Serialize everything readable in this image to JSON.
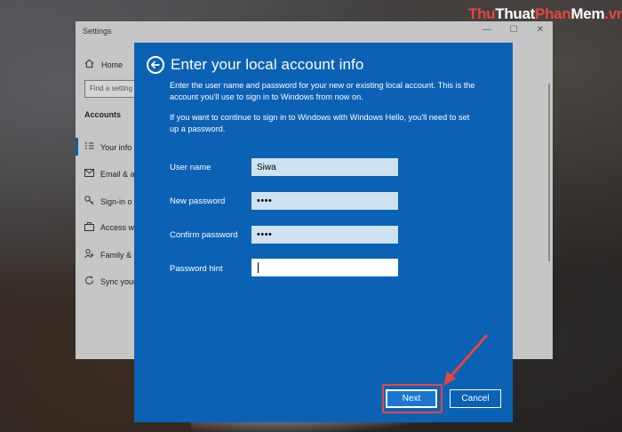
{
  "watermark": {
    "part1": "Thu",
    "part2": "Thuat",
    "part3": "Phan",
    "part4": "Mem",
    "part5": ".vn"
  },
  "settings_window": {
    "title": "Settings",
    "controls": {
      "minimize": "—",
      "maximize": "☐",
      "close": "✕"
    },
    "home_label": "Home",
    "find_placeholder": "Find a setting",
    "section_label": "Accounts",
    "items": [
      {
        "label": "Your info",
        "icon": "person-card-icon"
      },
      {
        "label": "Email & a",
        "icon": "mail-icon"
      },
      {
        "label": "Sign-in o",
        "icon": "key-icon"
      },
      {
        "label": "Access wo",
        "icon": "briefcase-icon"
      },
      {
        "label": "Family & o",
        "icon": "person-add-icon"
      },
      {
        "label": "Sync your",
        "icon": "sync-icon"
      }
    ]
  },
  "dialog": {
    "title": "Enter your local account info",
    "para1_line1": "Enter the user name and password for your new or existing local account. This is the",
    "para1_line2": "account you'll use to sign in to Windows from now on.",
    "para2_line1": "If you want to continue to sign in to Windows with Windows Hello, you'll need to set",
    "para2_line2": "up a password.",
    "fields": {
      "username": {
        "label": "User name",
        "value": "Siwa"
      },
      "new_password": {
        "label": "New password",
        "value": "••••"
      },
      "confirm_password": {
        "label": "Confirm password",
        "value": "••••"
      },
      "password_hint": {
        "label": "Password hint",
        "value": ""
      }
    },
    "next_label": "Next",
    "cancel_label": "Cancel"
  },
  "colors": {
    "dialog_bg": "#0b62b5",
    "annotation_red": "#e8453c"
  }
}
